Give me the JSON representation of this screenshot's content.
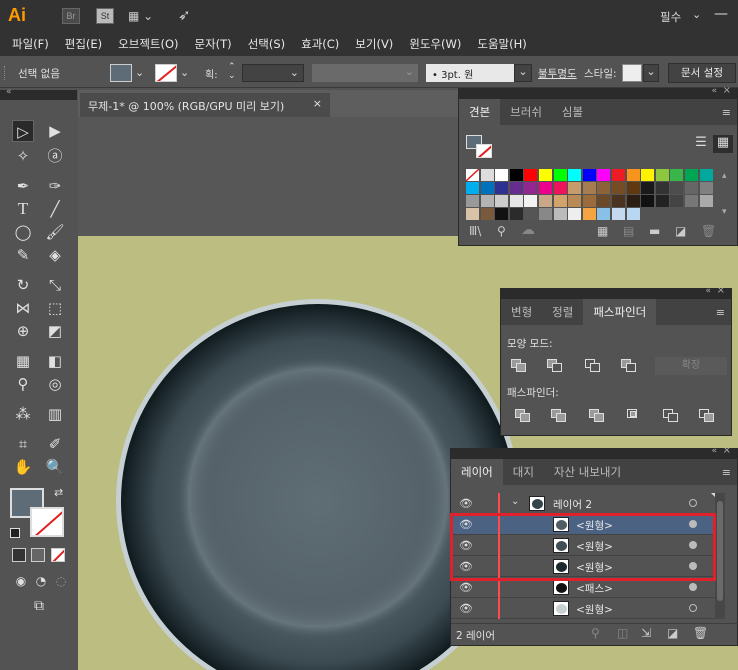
{
  "app": {
    "logo": "Ai",
    "br": "Br",
    "st": "St",
    "workspace": "필수"
  },
  "menu": [
    "파일(F)",
    "편집(E)",
    "오브젝트(O)",
    "문자(T)",
    "선택(S)",
    "효과(C)",
    "보기(V)",
    "윈도우(W)",
    "도움말(H)"
  ],
  "control": {
    "selection": "선택 없음",
    "stroke_label": "획:",
    "brush_value": "3pt. 원",
    "opacity_label": "불투명도",
    "style_label": "스타일:",
    "doc_setup": "문서 설정"
  },
  "document": {
    "tab_title": "무제-1* @ 100% (RGB/GPU 미리 보기)",
    "close": "×"
  },
  "swatches_panel": {
    "tabs": [
      "견본",
      "브러쉬",
      "심볼"
    ]
  },
  "pathfinder_panel": {
    "tabs": [
      "변형",
      "정렬",
      "패스파인더"
    ],
    "shape_modes": "모양 모드:",
    "expand": "확장",
    "pathfinders": "패스파인더:"
  },
  "layers_panel": {
    "tabs": [
      "레이어",
      "대지",
      "자산 내보내기"
    ],
    "layer_name": "레이어 2",
    "items": [
      "<원형>",
      "<원형>",
      "<원형>",
      "<패스>",
      "<원형>"
    ],
    "footer": "2 레이어"
  },
  "colors": {
    "artboard": "#bbbe80",
    "highlight": "#e0202a",
    "selected_row": "#4c6283",
    "accent": "#ff9a00"
  }
}
